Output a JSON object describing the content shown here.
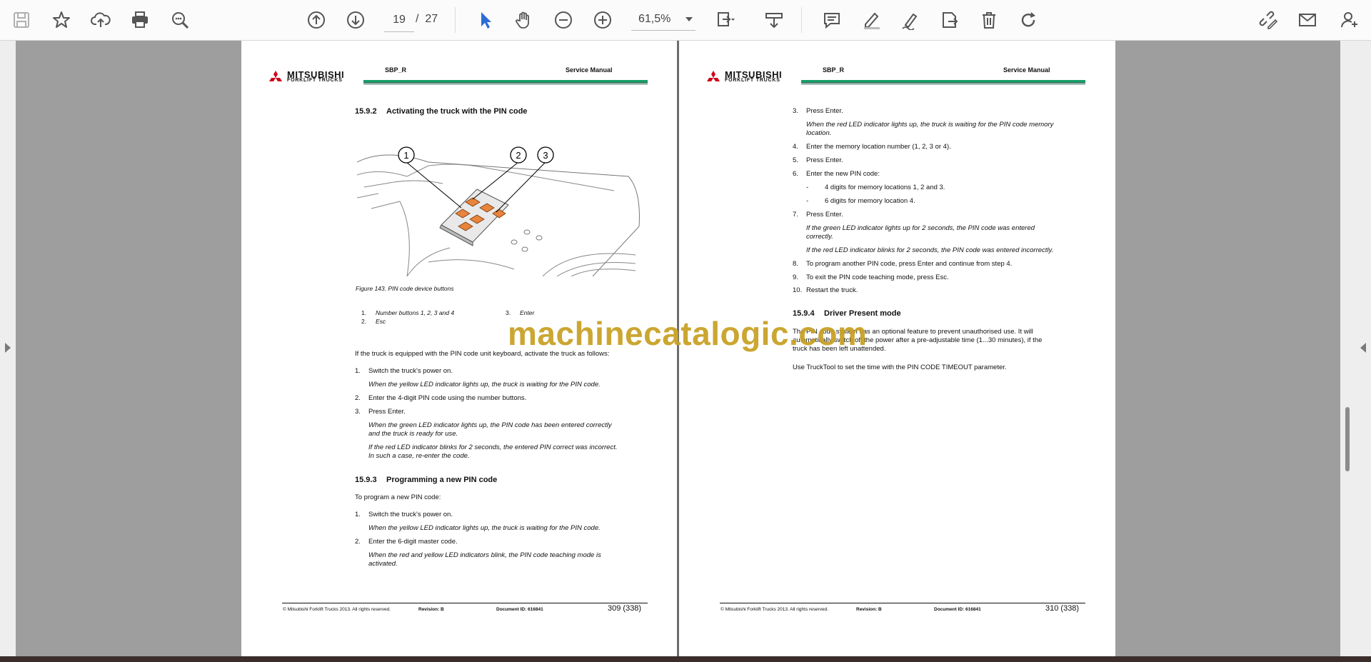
{
  "toolbar": {
    "page_current": "19",
    "page_separator": "/",
    "page_total": "27",
    "zoom": "61,5%",
    "icons_left": [
      "save-icon",
      "bookmark-star-icon",
      "upload-cloud-icon",
      "print-icon",
      "zoom-search-icon"
    ],
    "icons_nav": [
      "page-up-icon",
      "page-down-icon"
    ],
    "icons_tools": [
      "select-cursor-icon",
      "hand-tool-icon",
      "zoom-out-icon",
      "zoom-in-icon"
    ],
    "icons_right": [
      "fit-page-icon",
      "download-scroll-icon",
      "comment-icon",
      "highlight-pen-icon",
      "sign-icon",
      "edit-export-icon",
      "delete-trash-icon",
      "rotate-icon",
      "link-edit-icon",
      "email-icon",
      "add-user-icon"
    ],
    "accent_color": "#2b6cd6"
  },
  "document": {
    "header_doc": "SBP_R",
    "header_title": "Service Manual",
    "logo_text": "MITSUBISHI",
    "logo_sub": "FORKLIFT TRUCKS",
    "accent_green": "#17a06a"
  },
  "left_page": {
    "section_num": "15.9.2",
    "section_title": "Activating the truck with the PIN code",
    "callouts": [
      "1",
      "2",
      "3"
    ],
    "figure_caption": "Figure 143. PIN code device buttons",
    "legend": [
      {
        "num": "1.",
        "text": "Number buttons 1, 2, 3 and 4"
      },
      {
        "num": "2.",
        "text": "Esc"
      },
      {
        "num": "3.",
        "text": "Enter"
      }
    ],
    "intro": "If the truck is equipped with the PIN code unit keyboard, activate the truck as follows:",
    "steps": [
      {
        "num": "1.",
        "text": "Switch the truck's power on."
      },
      {
        "note": "When the yellow LED indicator lights up, the truck is waiting for the PIN code."
      },
      {
        "num": "2.",
        "text": "Enter the 4-digit PIN code using the number buttons."
      },
      {
        "num": "3.",
        "text": "Press Enter."
      },
      {
        "note": "When the green LED indicator lights up, the PIN code has been entered correctly"
      },
      {
        "note": "and the truck is ready for use."
      },
      {
        "note": "If the red LED indicator blinks for 2 seconds, the entered PIN correct was incorrect."
      },
      {
        "note": "In such a case, re-enter the code."
      }
    ],
    "section2_num": "15.9.3",
    "section2_title": "Programming a new PIN code",
    "section2_intro": "To program a new PIN code:",
    "section2_steps": [
      {
        "num": "1.",
        "text": "Switch the truck's power on."
      },
      {
        "note": "When the yellow LED indicator lights up, the truck is waiting for the PIN code."
      },
      {
        "num": "2.",
        "text": "Enter the 6-digit master code."
      },
      {
        "note": "When the red and yellow LED indicators blink, the PIN code teaching mode is"
      },
      {
        "note": "activated."
      }
    ],
    "footer": {
      "copyright": "© Mitsubishi Forklift Trucks 2013. All rights reserved.",
      "revision": "Revision: B",
      "document_id": "Document ID: 616841",
      "page": "309 (338)"
    }
  },
  "right_page": {
    "steps": [
      {
        "num": "3.",
        "text": "Press Enter."
      },
      {
        "note": "When the red LED indicator lights up, the truck is waiting for the PIN code memory"
      },
      {
        "note": "location."
      },
      {
        "num": "4.",
        "text": "Enter the memory location number (1, 2, 3 or 4)."
      },
      {
        "num": "5.",
        "text": "Press Enter."
      },
      {
        "num": "6.",
        "text": "Enter the new PIN code:"
      },
      {
        "dash": "-",
        "text": "4 digits for memory locations 1, 2 and 3."
      },
      {
        "dash": "-",
        "text": "6 digits for memory location 4."
      },
      {
        "num": "7.",
        "text": "Press Enter."
      },
      {
        "note": "If the green LED indicator lights up for 2 seconds, the PIN code was entered"
      },
      {
        "note": "correctly."
      },
      {
        "note": "If the red LED indicator blinks for 2 seconds, the PIN code was entered incorrectly."
      },
      {
        "num": "8.",
        "text": "To program another PIN code, press Enter and continue from step 4."
      },
      {
        "num": "9.",
        "text": "To exit the PIN code teaching mode, press Esc."
      },
      {
        "num": "10.",
        "text": "Restart the truck."
      }
    ],
    "section_num": "15.9.4",
    "section_title": "Driver Present mode",
    "para1_line1": "The PIN code system has an optional feature to prevent unauthorised use. It will",
    "para1_line2": "automatically switch off the power after a pre-adjustable time (1...30 minutes), if the",
    "para1_line3": "truck has been left unattended.",
    "para2": "Use TruckTool to set the time with the PIN CODE TIMEOUT parameter.",
    "footer": {
      "copyright": "© Mitsubishi Forklift Trucks 2013. All rights reserved.",
      "revision": "Revision: B",
      "document_id": "Document ID: 616841",
      "page": "310 (338)"
    }
  },
  "watermark": "machinecatalogic.com"
}
